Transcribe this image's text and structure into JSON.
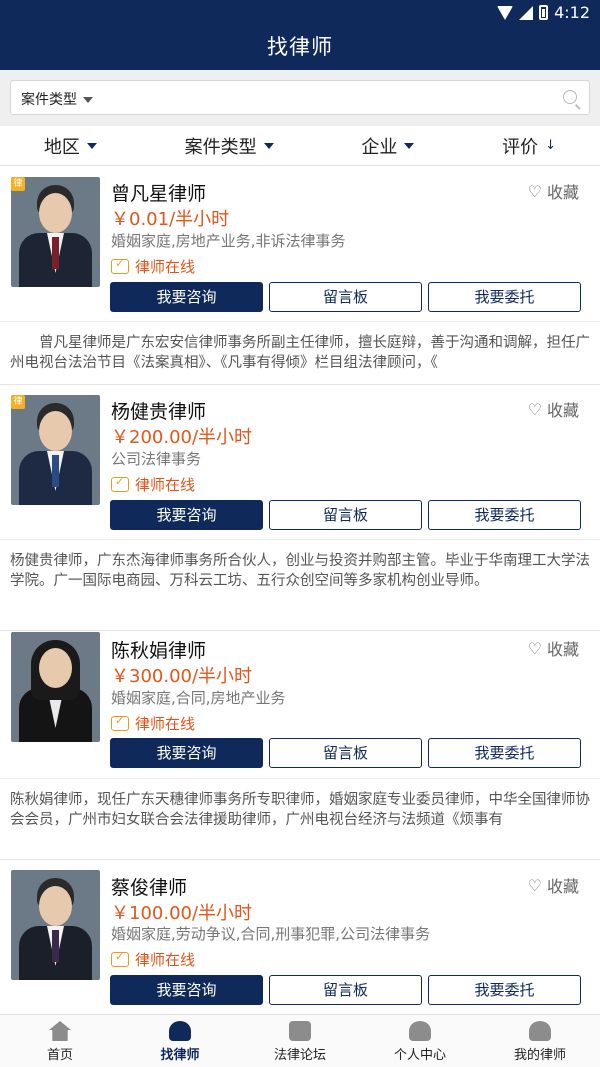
{
  "status": {
    "time": "4:12"
  },
  "header": {
    "title": "找律师"
  },
  "search": {
    "filter_label": "案件类型",
    "placeholder": ""
  },
  "filters": {
    "region": "地区",
    "case_type": "案件类型",
    "company": "企业",
    "rating": "评价",
    "rating_arrow": "↓"
  },
  "lawyers": [
    {
      "name": "曾凡星律师",
      "price": "￥0.01/半小时",
      "tags": "婚姻家庭,房地产业务,非诉法律事务",
      "online": "律师在线",
      "fav": "收藏",
      "consult": "我要咨询",
      "message": "留言板",
      "entrust": "我要委托",
      "desc": "　　曾凡星律师是广东宏安信律师事务所副主任律师，擅长庭辩，善于沟通和调解，担任广州电视台法治节目《法案真相》、《凡事有得倾》栏目组法律顾问，《",
      "badge": true
    },
    {
      "name": "杨健贵律师",
      "price": "￥200.00/半小时",
      "tags": "公司法律事务",
      "online": "律师在线",
      "fav": "收藏",
      "consult": "我要咨询",
      "message": "留言板",
      "entrust": "我要委托",
      "desc": "杨健贵律师，广东杰海律师事务所合伙人，创业与投资并购部主管。毕业于华南理工大学法学院。广一国际电商园、万科云工坊、五行众创空间等多家机构创业导师。",
      "badge": true
    },
    {
      "name": "陈秋娟律师",
      "price": "￥300.00/半小时",
      "tags": "婚姻家庭,合同,房地产业务",
      "online": "律师在线",
      "fav": "收藏",
      "consult": "我要咨询",
      "message": "留言板",
      "entrust": "我要委托",
      "desc": "陈秋娟律师，现任广东天穗律师事务所专职律师，婚姻家庭专业委员律师，中华全国律师协会会员，广州市妇女联合会法律援助律师，广州电视台经济与法频道《烦事有",
      "badge": false
    },
    {
      "name": "蔡俊律师",
      "price": "￥100.00/半小时",
      "tags": "婚姻家庭,劳动争议,合同,刑事犯罪,公司法律事务",
      "online": "律师在线",
      "fav": "收藏",
      "consult": "我要咨询",
      "message": "留言板",
      "entrust": "我要委托",
      "desc": "",
      "badge": false
    }
  ],
  "badge_icon": "律",
  "nav": [
    {
      "label": "首页",
      "icon": "home-icon"
    },
    {
      "label": "找律师",
      "icon": "lawyer-icon"
    },
    {
      "label": "法律论坛",
      "icon": "forum-icon"
    },
    {
      "label": "个人中心",
      "icon": "person-icon"
    },
    {
      "label": "我的律师",
      "icon": "my-lawyer-icon"
    }
  ]
}
